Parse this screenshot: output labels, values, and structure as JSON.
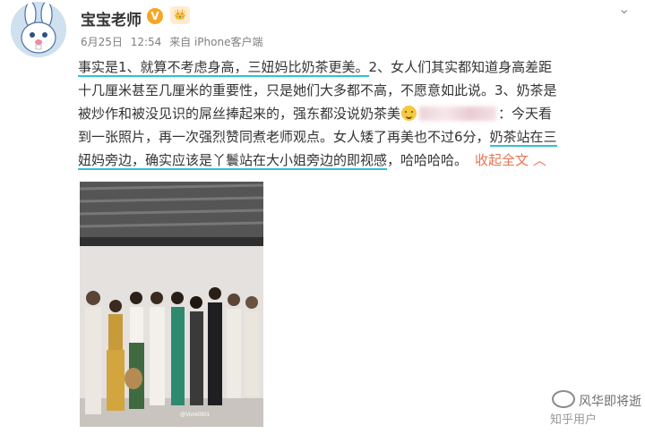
{
  "header": {
    "username": "宝宝老师",
    "verified_badge": "V",
    "level_badge": "👑",
    "more_icon": "chevron-down-icon"
  },
  "meta": {
    "date": "6月25日",
    "time": "12:54",
    "source": "来自 iPhone客户端"
  },
  "post": {
    "line1": [
      "事实是1、就算不考虑身高，三妞妈比奶茶更美。",
      "2、女人们其实都知道身高差距"
    ],
    "line2": "十几厘米甚至几厘米的重要性，只是她们大多都不高，不愿意如此说。3、奶茶是",
    "line3_a": "被炒作和被没见识的屌丝捧起来的，强东都没说奶茶美",
    "line3_b": "：今天看",
    "line4_a": "到一张照片，再一次强烈赞同煮老师观点。女人矮了再美也不过6分，",
    "line4_b": "奶茶站在三",
    "line5_a": "妞妈旁边，确实应该是丫鬟站在大小姐旁边的即视感",
    "line5_b": "，哈哈哈哈。",
    "collapse_label": "收起全文",
    "collapse_arrow": "︿"
  },
  "photo": {
    "caption": "@Vivre0301"
  },
  "watermark": {
    "text": "风华即将逝",
    "sub": "知乎用户"
  },
  "colors": {
    "highlight_underline": "#2ec2d4",
    "collapse_link": "#eb7350",
    "badge_orange": "#f6a623"
  }
}
